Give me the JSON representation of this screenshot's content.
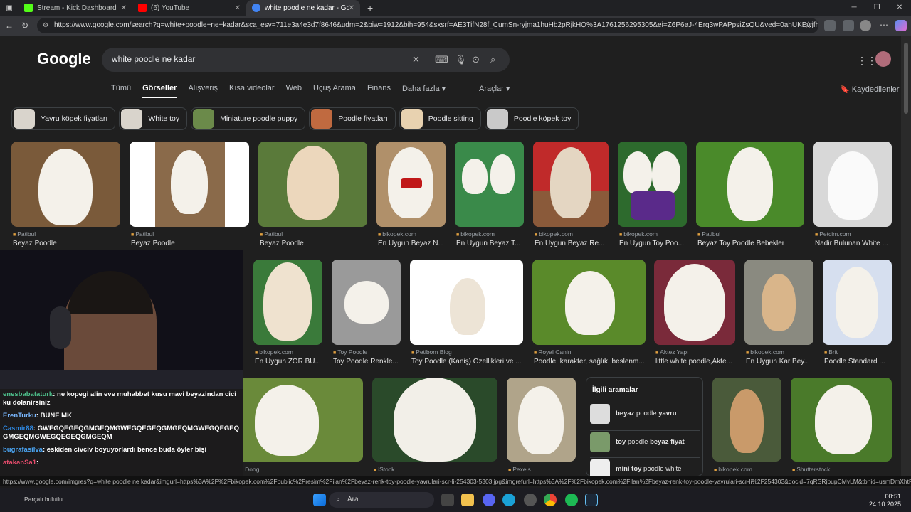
{
  "browser": {
    "tabs": [
      {
        "title": "Stream - Kick Dashboard",
        "color": "#53fc18",
        "active": false
      },
      {
        "title": "(6) YouTube",
        "color": "#ff0000",
        "active": false
      },
      {
        "title": "white poodle ne kadar - Google'd",
        "color": "#4285f4",
        "active": true
      }
    ],
    "url": "https://www.google.com/search?q=white+poodle+ne+kadar&sca_esv=711e3a4e3d7f8646&udm=2&biw=1912&bih=954&sxsrf=AE3TifN28f_CumSn-ryjma1huHb2pRjkHQ%3A1761256295305&ei=Z6P6aJ-4Erq3wPAPpsiZsQU&ved=0ahUKEwjfh9z-pruQA..."
  },
  "google": {
    "logo": "Google",
    "query": "white poodle ne kadar",
    "tabs": [
      "Tümü",
      "Görseller",
      "Alışveriş",
      "Kısa videolar",
      "Web",
      "Uçuş Arama",
      "Finans",
      "Daha fazla ▾"
    ],
    "active_tab": "Görseller",
    "tools": "Araçlar ▾",
    "saved": "Kaydedilenler",
    "chips": [
      "Yavru köpek fiyatları",
      "White toy",
      "Miniature poodle puppy",
      "Poodle fiyatları",
      "Poodle sitting",
      "Poodle köpek toy"
    ],
    "row1": [
      {
        "src": "Patibul",
        "title": "Beyaz Poodle"
      },
      {
        "src": "Patibul",
        "title": "Beyaz Poodle"
      },
      {
        "src": "Patibul",
        "title": "Beyaz Poodle"
      },
      {
        "src": "bikopek.com",
        "title": "En Uygun Beyaz N..."
      },
      {
        "src": "bikopek.com",
        "title": "En Uygun Beyaz T..."
      },
      {
        "src": "bikopek.com",
        "title": "En Uygun Beyaz Re..."
      },
      {
        "src": "bikopek.com",
        "title": "En Uygun Toy Poo..."
      },
      {
        "src": "Patibul",
        "title": "Beyaz Toy Poodle Bebekler"
      },
      {
        "src": "Petcim.com",
        "title": "Nadir Bulunan White ..."
      }
    ],
    "row2": [
      {
        "src": "bikopek.com",
        "title": "En Uygun ZOR BU..."
      },
      {
        "src": "Toy Poodle",
        "title": "Toy Poodle Renkle..."
      },
      {
        "src": "Petibom Blog",
        "title": "Toy Poodle (Kaniş) Özellikleri ve ..."
      },
      {
        "src": "Royal Canin",
        "title": "Poodle: karakter, sağlık, beslenm..."
      },
      {
        "src": "Aktez Yapı",
        "title": "little white poodle,Akte..."
      },
      {
        "src": "bikopek.com",
        "title": "En Uygun Kar Bey..."
      },
      {
        "src": "Brit",
        "title": "Poodle Standard ..."
      }
    ],
    "row3_sources": [
      "Lusi Doog",
      "iStock",
      "Pexels",
      "bikopek.com",
      "Shutterstock"
    ],
    "related": {
      "heading": "İlgili aramalar",
      "items": [
        {
          "bold": "beyaz",
          "rest": " poodle ",
          "bold2": "yavru"
        },
        {
          "bold": "toy",
          "rest": " poodle ",
          "bold2": "beyaz fiyat"
        },
        {
          "bold": "mini toy",
          "rest": " poodle white",
          "bold2": ""
        }
      ]
    }
  },
  "status_url": "https://www.google.com/imgres?q=white poodle ne kadar&imgurl=https%3A%2F%2Fbikopek.com%2Fpublic%2Fresim%2Filan%2Fbeyaz-renk-toy-poodle-yavrulari-scr-li-254303-5303.jpg&imgrefurl=https%3A%2F%2Fbikopek.com%2Filan%2Fbeyaz-renk-toy-poodle-yavrulari-scr-li%2F254303&docid=7qRSRjbupCMvLM&tbnid=usmDmXhtRFUEaM&v...",
  "chat": {
    "messages": [
      {
        "user": "enesbabataturk",
        "text": ": ne kopegi alin eve muhabbet kusu mavi beyazindan cici ku dolanirsiniz",
        "cls": "u1"
      },
      {
        "user": "ErenTurku",
        "text": ": BUNE MK",
        "cls": "u2"
      },
      {
        "user": "Casmir88",
        "text": ": GWEGQEGEQGMGEQMGWEGQEGEQGMGEQMGWEGQEGEQGMGEQMGWEGQEGEQGMGEQM",
        "cls": "u3"
      },
      {
        "user": "bugrafasilva",
        "text": ": eskiden civciv boyuyorlardı bence buda öyler bişi",
        "cls": "u4"
      },
      {
        "user": "atakanSa1",
        "text": ":",
        "cls": "u5"
      }
    ],
    "footer": "Parçalı bulutlu"
  },
  "taskbar": {
    "search": "Ara",
    "time": "00:51",
    "date": "24.10.2025"
  }
}
